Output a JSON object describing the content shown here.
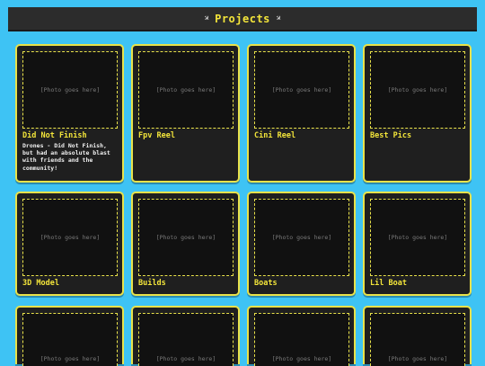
{
  "header": {
    "title": "Projects",
    "left_icon": "rocket-icon",
    "right_icon": "rocket-icon"
  },
  "photo_placeholder": "[Photo goes here]",
  "cards": [
    {
      "title": "Did Not Finish",
      "description": "Drones - Did Not Finish, but had an absolute blast with friends and the community!"
    },
    {
      "title": "Fpv Reel",
      "description": ""
    },
    {
      "title": "Cini Reel",
      "description": ""
    },
    {
      "title": "Best Pics",
      "description": ""
    },
    {
      "title": "3D Model",
      "description": ""
    },
    {
      "title": "Builds",
      "description": ""
    },
    {
      "title": "Boats",
      "description": ""
    },
    {
      "title": "Lil Boat",
      "description": ""
    },
    {
      "title": "",
      "description": ""
    },
    {
      "title": "",
      "description": ""
    },
    {
      "title": "",
      "description": ""
    },
    {
      "title": "",
      "description": ""
    }
  ],
  "colors": {
    "background": "#3ec3f4",
    "card": "#1f1f1f",
    "accent": "#e9e24a",
    "header": "#2c2c2c"
  }
}
